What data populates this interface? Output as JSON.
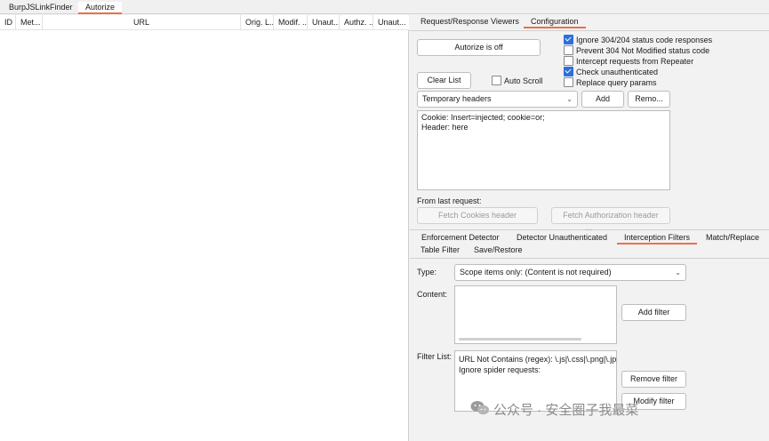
{
  "top_tabs": [
    {
      "label": "BurpJSLinkFinder"
    },
    {
      "label": "Autorize"
    }
  ],
  "table": {
    "columns": [
      "ID",
      "Met...",
      "URL",
      "Orig. L...",
      "Modif. ...",
      "Unaut...",
      "Authz. ...",
      "Unaut..."
    ]
  },
  "right_tabs": [
    {
      "label": "Request/Response Viewers"
    },
    {
      "label": "Configuration"
    }
  ],
  "config": {
    "autorize_button": "Autorize is off",
    "clear_list_button": "Clear List",
    "auto_scroll": {
      "label": "Auto Scroll",
      "checked": false
    },
    "options": [
      {
        "label": "Ignore 304/204 status code responses",
        "checked": true
      },
      {
        "label": "Prevent 304 Not Modified status code",
        "checked": false
      },
      {
        "label": "Intercept requests from Repeater",
        "checked": false
      },
      {
        "label": "Check unauthenticated",
        "checked": true
      },
      {
        "label": "Replace query params",
        "checked": false
      }
    ],
    "headers_select": "Temporary headers",
    "add_button": "Add",
    "remove_button": "Remo...",
    "headers_text_line1": "Cookie: Insert=injected; cookie=or;",
    "headers_text_line2": "Header: here",
    "from_last_request_label": "From last request:",
    "fetch_cookies_button": "Fetch Cookies header",
    "fetch_auth_button": "Fetch Authorization header"
  },
  "bottom_tabs_row1": [
    {
      "label": "Enforcement Detector"
    },
    {
      "label": "Detector Unauthenticated"
    },
    {
      "label": "Interception Filters"
    },
    {
      "label": "Match/Replace"
    }
  ],
  "bottom_tabs_row2": [
    {
      "label": "Table Filter"
    },
    {
      "label": "Save/Restore"
    }
  ],
  "filters": {
    "type_label": "Type:",
    "type_value": "Scope items only: (Content is not required)",
    "content_label": "Content:",
    "add_filter_button": "Add filter",
    "filter_list_label": "Filter List:",
    "filter_list_items": [
      "URL Not Contains (regex): \\.js|\\.css|\\.png|\\.jpg",
      "Ignore spider requests:"
    ],
    "remove_filter_button": "Remove filter",
    "modify_filter_button": "Modify filter"
  },
  "watermark": "公众号 · 安全圈子我最菜",
  "colors": {
    "accent": "#e8714a",
    "checkbox": "#2f6fd6"
  }
}
